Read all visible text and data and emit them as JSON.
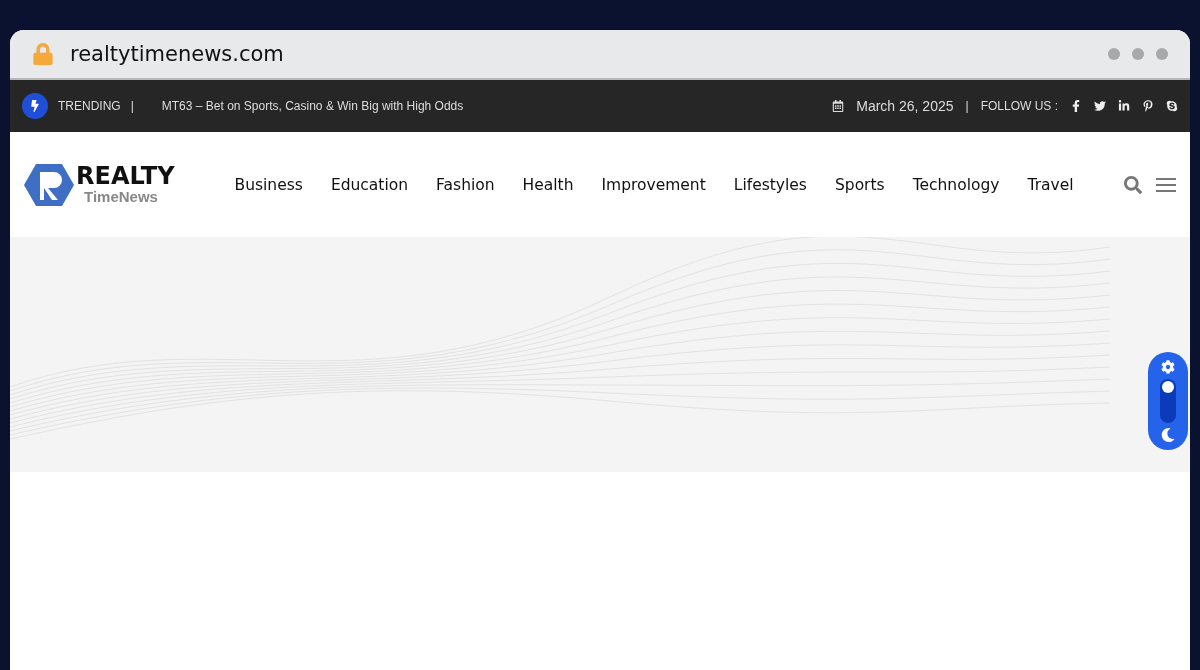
{
  "browser": {
    "address": "realtytimenews.com"
  },
  "topbar": {
    "trending_label": "TRENDING",
    "separator": "|",
    "headline": "MT63 – Bet on Sports, Casino & Win Big with High Odds",
    "date": "March 26, 2025",
    "follow_label": "FOLLOW US :"
  },
  "logo": {
    "title": "REALTY",
    "subtitle": "TimeNews"
  },
  "nav": [
    {
      "label": "Business"
    },
    {
      "label": "Education"
    },
    {
      "label": "Fashion"
    },
    {
      "label": "Health"
    },
    {
      "label": "Improvement"
    },
    {
      "label": "Lifestyles"
    },
    {
      "label": "Sports"
    },
    {
      "label": "Technology"
    },
    {
      "label": "Travel"
    }
  ],
  "theme_switch": {
    "on": false
  }
}
